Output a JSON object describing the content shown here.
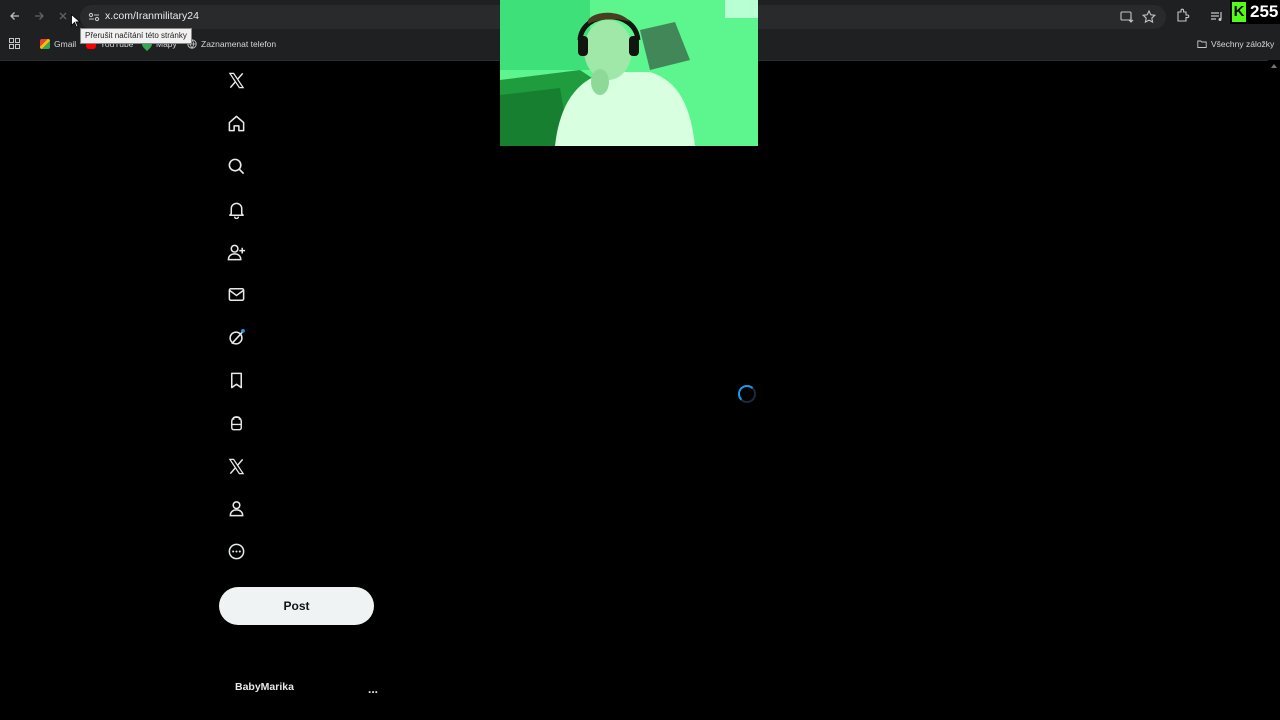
{
  "browser": {
    "url": "x.com/Iranmilitary24",
    "stop_tooltip": "Přerušit načítání této stránky",
    "bookmarks": [
      {
        "label": "Gmail",
        "icon": "gmail-icon"
      },
      {
        "label": "YouTube",
        "icon": "youtube-icon"
      },
      {
        "label": "Mapy",
        "icon": "maps-icon"
      },
      {
        "label": "Zaznamenat telefon",
        "icon": "globe-icon"
      }
    ],
    "all_bookmarks_label": "Všechny záložky"
  },
  "stream": {
    "kick_logo": "K",
    "viewer_count": "255",
    "accent_color": "#53fc18"
  },
  "sidebar": {
    "items": [
      {
        "name": "x-logo-icon"
      },
      {
        "name": "home-icon"
      },
      {
        "name": "explore-icon"
      },
      {
        "name": "notifications-icon"
      },
      {
        "name": "follow-icon"
      },
      {
        "name": "messages-icon"
      },
      {
        "name": "grok-icon"
      },
      {
        "name": "bookmarks-icon"
      },
      {
        "name": "jobs-icon"
      },
      {
        "name": "premium-icon"
      },
      {
        "name": "profile-icon"
      },
      {
        "name": "more-icon"
      }
    ],
    "post_label": "Post",
    "account_name": "BabyMarika",
    "account_more": "..."
  },
  "colors": {
    "background": "#000000",
    "post_button": "#eff3f4",
    "spinner": "#1d9bf0"
  }
}
